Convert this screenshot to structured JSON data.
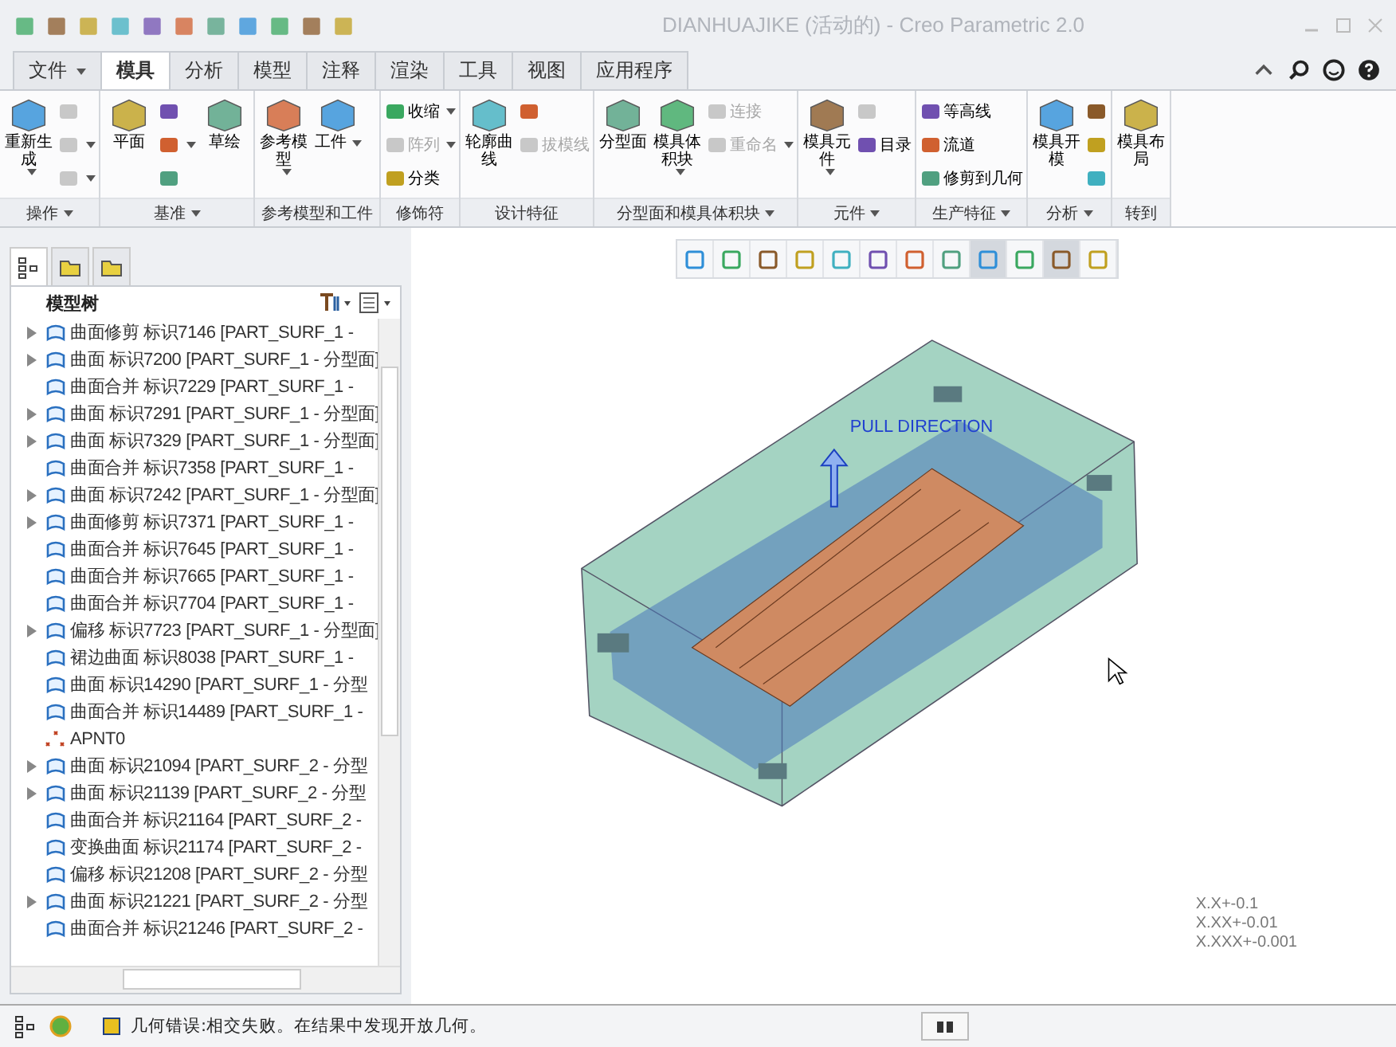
{
  "window": {
    "title": "DIANHUAJIKE (活动的) - Creo Parametric 2.0"
  },
  "menu_tabs": [
    {
      "label": "文件",
      "selected": false,
      "menu": true
    },
    {
      "label": "模具",
      "selected": true,
      "menu": false
    },
    {
      "label": "分析",
      "selected": false,
      "menu": false
    },
    {
      "label": "模型",
      "selected": false,
      "menu": false
    },
    {
      "label": "注释",
      "selected": false,
      "menu": false
    },
    {
      "label": "渲染",
      "selected": false,
      "menu": false
    },
    {
      "label": "工具",
      "selected": false,
      "menu": false
    },
    {
      "label": "视图",
      "selected": false,
      "menu": false
    },
    {
      "label": "应用程序",
      "selected": false,
      "menu": false
    }
  ],
  "ribbon_groups": [
    {
      "label": "操作",
      "menu": true,
      "items": [
        {
          "kind": "large",
          "label": "重新生成",
          "menu": true
        },
        {
          "kind": "stack",
          "items": [
            {
              "menu": false,
              "disabled": true
            },
            {
              "menu": true,
              "disabled": true
            },
            {
              "menu": true,
              "disabled": true
            }
          ]
        }
      ]
    },
    {
      "label": "基准",
      "menu": true,
      "items": [
        {
          "kind": "large",
          "label": "平面",
          "menu": false
        },
        {
          "kind": "stack",
          "items": [
            {
              "menu": false,
              "disabled": false
            },
            {
              "menu": true,
              "disabled": false
            },
            {
              "menu": false,
              "disabled": false
            }
          ]
        },
        {
          "kind": "large",
          "label": "草绘",
          "menu": false
        }
      ]
    },
    {
      "label": "参考模型和工件",
      "menu": false,
      "items": [
        {
          "kind": "large",
          "label": "参考模型",
          "menu": true
        },
        {
          "kind": "large",
          "label": "工件",
          "menu": true
        }
      ]
    },
    {
      "label": "修饰符",
      "menu": false,
      "items": [
        {
          "kind": "stack",
          "items": [
            {
              "label": "收缩",
              "menu": true,
              "disabled": false
            },
            {
              "label": "阵列",
              "menu": true,
              "disabled": true
            },
            {
              "label": "分类",
              "menu": false,
              "disabled": false
            }
          ]
        }
      ]
    },
    {
      "label": "设计特征",
      "menu": false,
      "items": [
        {
          "kind": "large",
          "label": "轮廓曲线",
          "menu": false
        },
        {
          "kind": "stack",
          "items": [
            {
              "menu": false,
              "disabled": false
            },
            {
              "label": "拔模线",
              "menu": false,
              "disabled": true
            }
          ]
        }
      ]
    },
    {
      "label": "分型面和模具体积块",
      "menu": true,
      "items": [
        {
          "kind": "large",
          "label": "分型面",
          "menu": false
        },
        {
          "kind": "large",
          "label": "模具体积块",
          "menu": true
        },
        {
          "kind": "stack",
          "items": [
            {
              "label": "连接",
              "menu": false,
              "disabled": true
            },
            {
              "label": "重命名",
              "menu": true,
              "disabled": true
            }
          ]
        }
      ]
    },
    {
      "label": "元件",
      "menu": true,
      "items": [
        {
          "kind": "large",
          "label": "模具元件",
          "menu": true
        },
        {
          "kind": "stack",
          "items": [
            {
              "menu": false,
              "disabled": true
            },
            {
              "label": "目录",
              "menu": false,
              "disabled": false
            }
          ]
        }
      ]
    },
    {
      "label": "生产特征",
      "menu": true,
      "items": [
        {
          "kind": "stack",
          "items": [
            {
              "label": "等高线",
              "menu": false,
              "disabled": false
            },
            {
              "label": "流道",
              "menu": false,
              "disabled": false
            },
            {
              "label": "修剪到几何",
              "menu": false,
              "disabled": false
            }
          ]
        }
      ]
    },
    {
      "label": "分析",
      "menu": true,
      "items": [
        {
          "kind": "large",
          "label": "模具开模",
          "menu": false
        },
        {
          "kind": "stack",
          "items": [
            {
              "menu": false,
              "disabled": false
            },
            {
              "menu": false,
              "disabled": false
            },
            {
              "menu": false,
              "disabled": false
            }
          ]
        }
      ]
    },
    {
      "label": "转到",
      "menu": false,
      "items": [
        {
          "kind": "large",
          "label": "模具布局",
          "menu": false
        }
      ]
    }
  ],
  "navigator_tabs": [
    {
      "selected": true
    },
    {
      "selected": false
    },
    {
      "selected": false
    }
  ],
  "model_tree": {
    "title": "模型树",
    "items": [
      {
        "label": "曲面修剪 标识7146 [PART_SURF_1 -",
        "kind": "surface",
        "expandable": true
      },
      {
        "label": "曲面 标识7200 [PART_SURF_1 - 分型面]",
        "kind": "surface",
        "expandable": true
      },
      {
        "label": "曲面合并 标识7229 [PART_SURF_1 -",
        "kind": "surface",
        "expandable": false
      },
      {
        "label": "曲面 标识7291 [PART_SURF_1 - 分型面]",
        "kind": "surface",
        "expandable": true
      },
      {
        "label": "曲面 标识7329 [PART_SURF_1 - 分型面]",
        "kind": "surface",
        "expandable": true
      },
      {
        "label": "曲面合并 标识7358 [PART_SURF_1 -",
        "kind": "surface",
        "expandable": false
      },
      {
        "label": "曲面 标识7242 [PART_SURF_1 - 分型面]",
        "kind": "surface",
        "expandable": true
      },
      {
        "label": "曲面修剪 标识7371 [PART_SURF_1 -",
        "kind": "surface",
        "expandable": true
      },
      {
        "label": "曲面合并 标识7645 [PART_SURF_1 -",
        "kind": "surface",
        "expandable": false
      },
      {
        "label": "曲面合并 标识7665 [PART_SURF_1 -",
        "kind": "surface",
        "expandable": false
      },
      {
        "label": "曲面合并 标识7704 [PART_SURF_1 -",
        "kind": "surface",
        "expandable": false
      },
      {
        "label": "偏移 标识7723 [PART_SURF_1 - 分型面]",
        "kind": "surface",
        "expandable": true
      },
      {
        "label": "裙边曲面 标识8038 [PART_SURF_1 -",
        "kind": "surface",
        "expandable": false
      },
      {
        "label": "曲面 标识14290 [PART_SURF_1 - 分型",
        "kind": "surface",
        "expandable": false
      },
      {
        "label": "曲面合并 标识14489 [PART_SURF_1 -",
        "kind": "surface",
        "expandable": false
      },
      {
        "label": "APNT0",
        "kind": "point",
        "expandable": false
      },
      {
        "label": "曲面 标识21094 [PART_SURF_2 - 分型",
        "kind": "surface",
        "expandable": true
      },
      {
        "label": "曲面 标识21139 [PART_SURF_2 - 分型",
        "kind": "surface",
        "expandable": true
      },
      {
        "label": "曲面合并 标识21164 [PART_SURF_2 -",
        "kind": "surface",
        "expandable": false
      },
      {
        "label": "变换曲面 标识21174 [PART_SURF_2 -",
        "kind": "surface",
        "expandable": false
      },
      {
        "label": "偏移 标识21208 [PART_SURF_2 - 分型",
        "kind": "surface",
        "expandable": false
      },
      {
        "label": "曲面 标识21221 [PART_SURF_2 - 分型",
        "kind": "surface",
        "expandable": true
      },
      {
        "label": "曲面合并 标识21246 [PART_SURF_2 -",
        "kind": "surface",
        "expandable": false
      }
    ]
  },
  "view_toolbar": [
    {
      "selected": false
    },
    {
      "selected": false
    },
    {
      "selected": false
    },
    {
      "selected": false
    },
    {
      "selected": false
    },
    {
      "selected": false
    },
    {
      "selected": false
    },
    {
      "selected": false
    },
    {
      "selected": true
    },
    {
      "selected": false
    },
    {
      "selected": true
    },
    {
      "selected": false
    }
  ],
  "graphics": {
    "pull_direction_label": "PULL DIRECTION",
    "tolerances": [
      "X.X+-0.1",
      "X.XX+-0.01",
      "X.XXX+-0.001"
    ]
  },
  "status_bar": {
    "message": "几何错误:相交失败。在结果中发现开放几何。"
  }
}
